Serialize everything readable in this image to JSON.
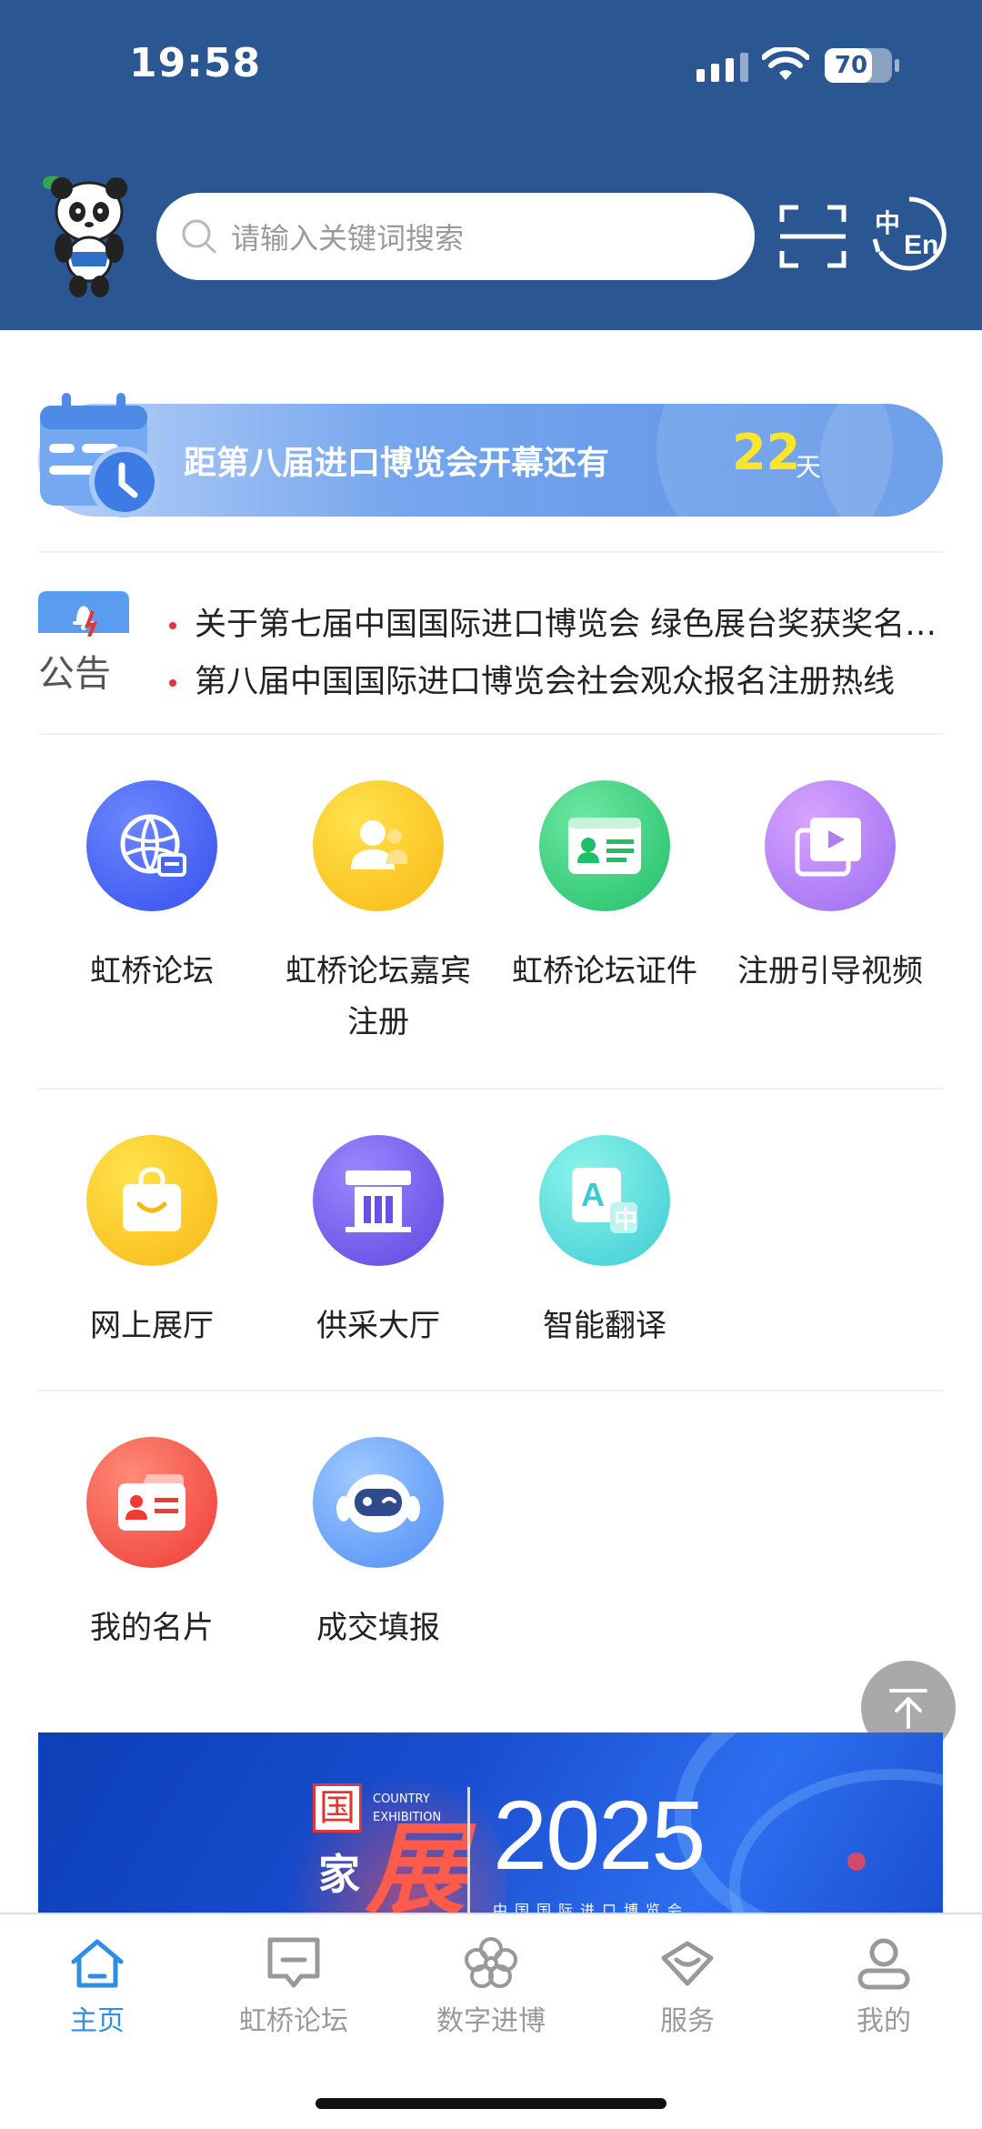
{
  "status_bar": {
    "time": "19:58",
    "battery": "70"
  },
  "search": {
    "placeholder": "请输入关键词搜索"
  },
  "countdown": {
    "text": "距第八届进口博览会开幕还有",
    "days": "22",
    "unit": "天"
  },
  "notice": {
    "label": "公告",
    "items": [
      "关于第七届中国国际进口博览会 绿色展台奖获奖名单的公示",
      "第八届中国国际进口博览会社会观众报名注册热线"
    ]
  },
  "grid": [
    {
      "label": "虹桥论坛",
      "icon": "globe-chat-icon"
    },
    {
      "label": "虹桥论坛嘉宾注册",
      "icon": "guest-icon"
    },
    {
      "label": "虹桥论坛证件",
      "icon": "id-card-icon"
    },
    {
      "label": "注册引导视频",
      "icon": "video-icon"
    },
    {
      "label": "网上展厅",
      "icon": "shopping-bag-icon"
    },
    {
      "label": "供采大厅",
      "icon": "hall-icon"
    },
    {
      "label": "智能翻译",
      "icon": "translate-icon"
    },
    {
      "label": "我的名片",
      "icon": "business-card-icon"
    },
    {
      "label": "成交填报",
      "icon": "robot-icon"
    }
  ],
  "promo": {
    "year": "2025",
    "country": "COUNTRY\nEXHIBITION",
    "guo": "国",
    "jia": "家",
    "zhan": "展",
    "sub": "中国国际进口博览会"
  },
  "tabs": [
    {
      "label": "主页",
      "active": true
    },
    {
      "label": "虹桥论坛",
      "active": false
    },
    {
      "label": "数字进博",
      "active": false
    },
    {
      "label": "服务",
      "active": false
    },
    {
      "label": "我的",
      "active": false
    }
  ],
  "colors": {
    "header": "#2a5791",
    "accent": "#2f8de4",
    "countdown_number": "#ffe52b"
  }
}
